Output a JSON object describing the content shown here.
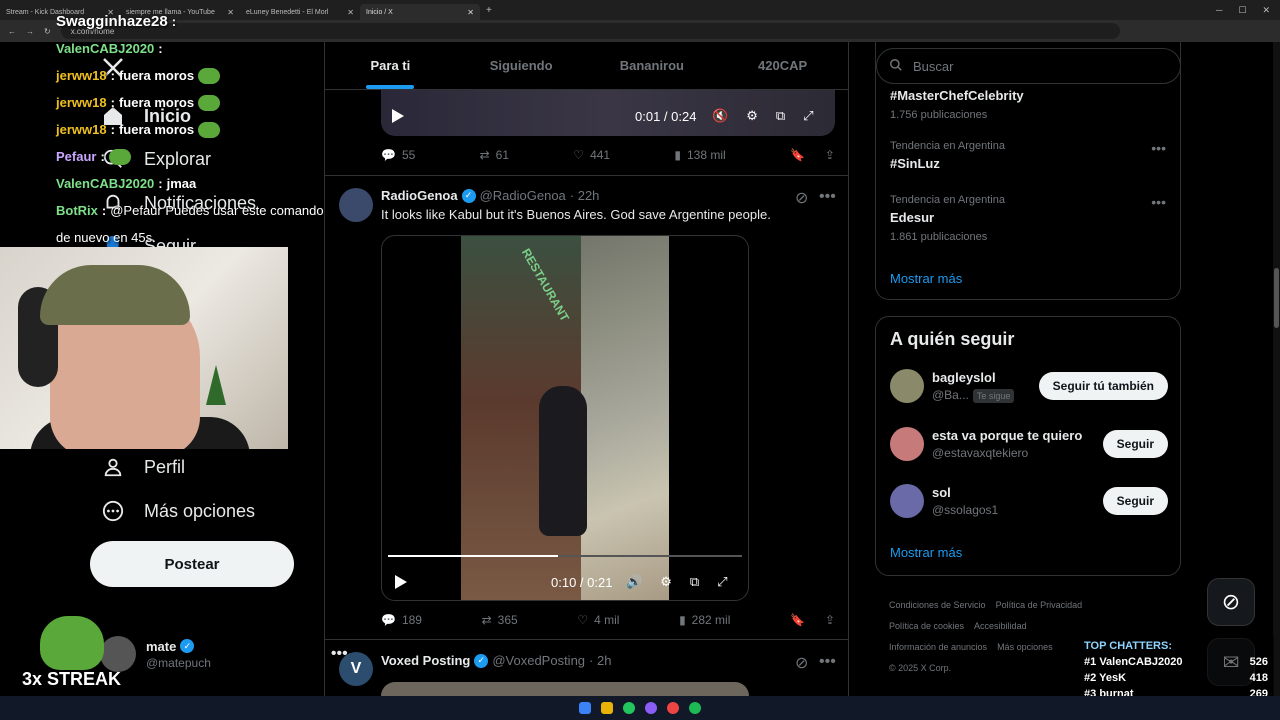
{
  "browser": {
    "tabs": [
      {
        "label": "Stream - Kick Dashboard",
        "active": false
      },
      {
        "label": "siempre me llama - YouTube",
        "active": false
      },
      {
        "label": "eLuney Benedetti - El Morl",
        "active": false
      },
      {
        "label": "Inicio / X",
        "active": true
      }
    ],
    "url": "x.com/home"
  },
  "nav": {
    "home": "Inicio",
    "explore": "Explorar",
    "notifications": "Notificaciones",
    "follow": "Seguir",
    "profile": "Perfil",
    "more": "Más opciones",
    "post_button": "Postear"
  },
  "account": {
    "name": "mate",
    "handle": "@matepuch"
  },
  "timeline": {
    "tabs": [
      "Para ti",
      "Siguiendo",
      "Bananirou",
      "420CAP"
    ],
    "active_tab": "Para ti",
    "tweet1": {
      "video_time": "0:01 / 0:24",
      "replies": "55",
      "reposts": "61",
      "likes": "441",
      "views": "138 mil"
    },
    "tweet2": {
      "name": "RadioGenoa",
      "handle": "@RadioGenoa",
      "time": "· 22h",
      "text": "It looks like Kabul but it's Buenos Aires. God save Argentine people.",
      "video_time": "0:10 / 0:21",
      "progress": 0.48,
      "replies": "189",
      "reposts": "365",
      "likes": "4 mil",
      "views": "282 mil"
    },
    "tweet3": {
      "name": "Voxed Posting",
      "handle": "@VoxedPosting",
      "time": "· 2h",
      "avatar_letter": "V"
    }
  },
  "right": {
    "search_placeholder": "Buscar",
    "trends": [
      {
        "context": "",
        "title": "#MasterChefCelebrity",
        "count": "1.756 publicaciones"
      },
      {
        "context": "Tendencia en Argentina",
        "title": "#SinLuz",
        "count": ""
      },
      {
        "context": "Tendencia en Argentina",
        "title": "Edesur",
        "count": "1.861 publicaciones"
      }
    ],
    "show_more": "Mostrar más",
    "who_to_follow_title": "A quién seguir",
    "suggestions": [
      {
        "name": "bagleyslol",
        "handle": "@Ba...",
        "badge": "Te sigue",
        "button": "Seguir tú también"
      },
      {
        "name": "esta va porque te quiero",
        "handle": "@estavaxqtekiero",
        "badge": "",
        "button": "Seguir"
      },
      {
        "name": "sol",
        "handle": "@ssolagos1",
        "badge": "",
        "button": "Seguir"
      }
    ],
    "show_more_2": "Mostrar más",
    "footer": {
      "terms": "Condiciones de Servicio",
      "privacy": "Política de Privacidad",
      "cookies": "Política de cookies",
      "accessibility": "Accesibilidad",
      "ads": "Información de anuncios",
      "more": "Más opciones",
      "copyright": "© 2025 X Corp."
    }
  },
  "stream": {
    "chat": [
      {
        "user": "Swagginhaze28",
        "color": "#ffffff",
        "msg": ""
      },
      {
        "user": "ValenCABJ2020",
        "color": "#7ee08a",
        "msg": ""
      },
      {
        "user": "jerww18",
        "color": "#f0c020",
        "msg": "fuera moros"
      },
      {
        "user": "jerww18",
        "color": "#f0c020",
        "msg": "fuera moros"
      },
      {
        "user": "jerww18",
        "color": "#f0c020",
        "msg": "fuera moros"
      },
      {
        "user": "Pefaur",
        "color": "#c9a6ff",
        "msg": ""
      },
      {
        "user": "ValenCABJ2020",
        "color": "#7ee08a",
        "msg": "jmaa"
      },
      {
        "user": "BotRix",
        "color": "#7ee08a",
        "msg": "@Pefaur Puedes usar este comando"
      },
      {
        "user": "",
        "color": "#ffffff",
        "msg": "de nuevo en 45s."
      }
    ],
    "streak": "3x STREAK",
    "top_chatters_title": "TOP CHATTERS:",
    "top_chatters": [
      {
        "rank": "#1",
        "name": "ValenCABJ2020",
        "count": "526"
      },
      {
        "rank": "#2",
        "name": "YesK",
        "count": "418"
      },
      {
        "rank": "#3",
        "name": "burnat",
        "count": "269"
      }
    ]
  },
  "colors": {
    "accent": "#1d9bf0",
    "background": "#000000",
    "border": "#2f3336",
    "muted": "#71767b"
  }
}
